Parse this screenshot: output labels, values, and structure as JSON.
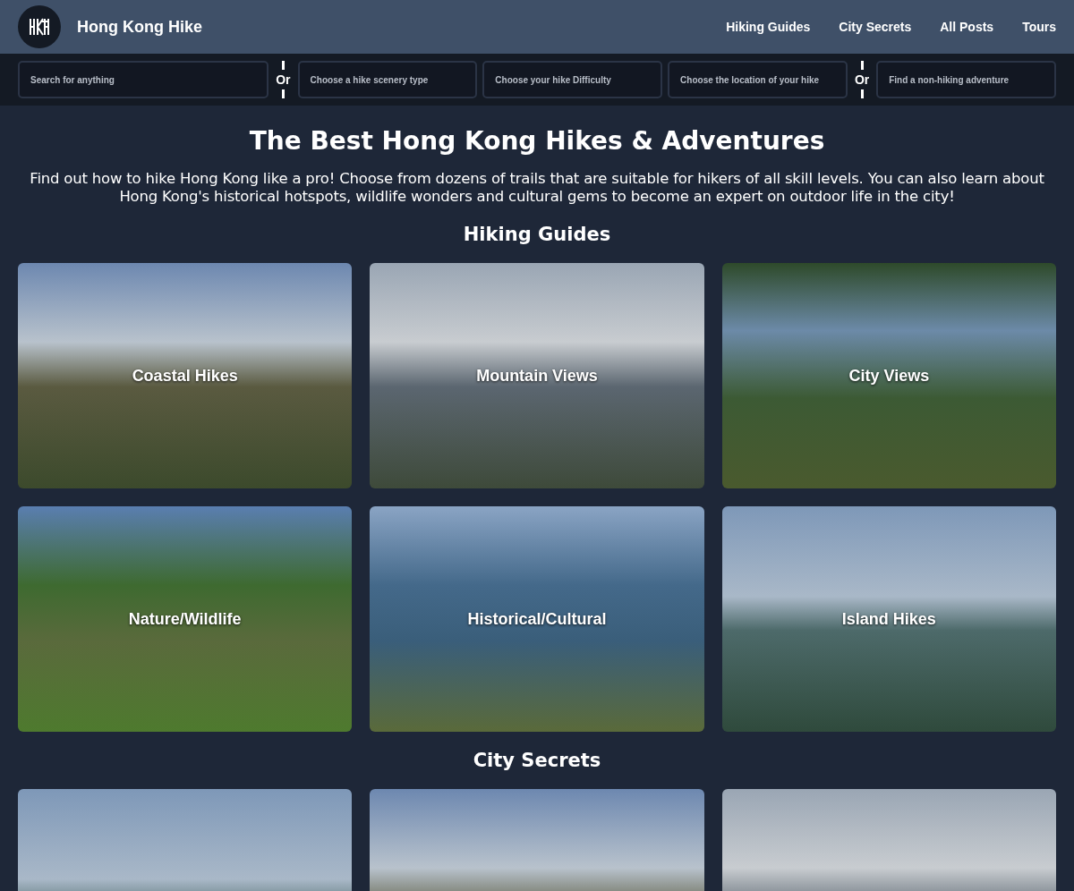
{
  "site": {
    "title": "Hong Kong Hike"
  },
  "nav": [
    "Hiking Guides",
    "City Secrets",
    "All Posts",
    "Tours"
  ],
  "filters": [
    {
      "kind": "field",
      "placeholder": "Search for anything"
    },
    {
      "kind": "divider",
      "label": "Or"
    },
    {
      "kind": "field",
      "placeholder": "Choose a hike scenery type"
    },
    {
      "kind": "field",
      "placeholder": "Choose your hike Difficulty"
    },
    {
      "kind": "field",
      "placeholder": "Choose the location of your hike"
    },
    {
      "kind": "divider",
      "label": "Or"
    },
    {
      "kind": "field",
      "placeholder": "Find a non-hiking adventure"
    }
  ],
  "heading": "The Best Hong Kong Hikes & Adventures",
  "intro": "Find out how to hike Hong Kong like a pro! Choose from dozens of trails that are suitable for hikers of all skill levels. You can also learn about Hong Kong's historical hotspots, wildlife wonders and cultural gems to become an expert on outdoor life in the city!",
  "sections": [
    {
      "title": "Hiking Guides",
      "cards": [
        {
          "kind": "photo",
          "label": "Coastal Hikes"
        },
        {
          "kind": "photo",
          "label": "Mountain Views"
        },
        {
          "kind": "photo",
          "label": "City Views"
        },
        {
          "kind": "photo",
          "label": "Nature/Wildlife"
        },
        {
          "kind": "photo",
          "label": "Historical/Cultural"
        },
        {
          "kind": "photo",
          "label": "Island Hikes"
        }
      ]
    },
    {
      "title": "City Secrets",
      "cards": [
        {
          "kind": "photo"
        },
        {
          "kind": "photo"
        },
        {
          "kind": "photo"
        }
      ]
    }
  ]
}
